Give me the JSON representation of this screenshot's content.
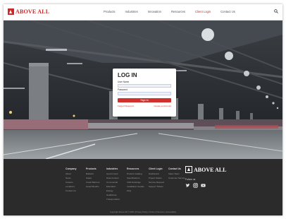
{
  "header": {
    "logo_text": "ABOVE ALL",
    "nav": [
      "Products",
      "Industries",
      "Innovation",
      "Resources",
      "Client Login",
      "Contact Us"
    ],
    "active_index": 4
  },
  "login": {
    "title": "LOG IN",
    "username_label": "User Name",
    "username_value": "",
    "password_label": "Password",
    "password_value": "",
    "button_label": "Sign In",
    "link_left": "Forgot Password",
    "link_right": "Create an Account"
  },
  "footer": {
    "columns": [
      {
        "heading": "Company",
        "items": [
          "About",
          "News",
          "Careers",
          "Locations",
          "Contact Us"
        ]
      },
      {
        "heading": "Products",
        "items": [
          "Bollards",
          "Gates",
          "Crash Barriers",
          "Guard Booths"
        ]
      },
      {
        "heading": "Industries",
        "items": [
          "Government",
          "Data Centers",
          "Commercial",
          "Education",
          "Energy",
          "Healthcare",
          "Transportation"
        ]
      },
      {
        "heading": "Resources",
        "items": [
          "Product Catalog",
          "Specifications",
          "CAD Drawings",
          "Installation Guides",
          "FAQ"
        ]
      },
      {
        "heading": "Client Login",
        "items": [
          "Dashboard",
          "Project Status",
          "Service Request",
          "Support Tickets"
        ]
      },
      {
        "heading": "Contact Us",
        "items": [
          "Sales Team",
          "Customer Service"
        ]
      }
    ],
    "logo_text": "ABOVE ALL",
    "follow_label": "Follow us",
    "social_icons": [
      "twitter-icon",
      "instagram-icon",
      "youtube-icon"
    ],
    "copyright": "Copyright Above All © 2025 | Privacy Policy | Terms of Service | Accessibility"
  },
  "colors": {
    "accent": "#d0312d",
    "footer_bg": "#2b2b2b"
  }
}
